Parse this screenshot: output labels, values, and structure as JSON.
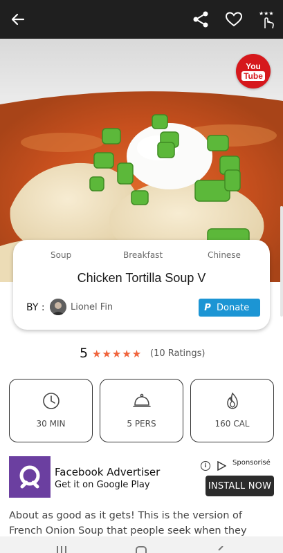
{
  "header": {
    "back_icon": "arrow-left-icon",
    "share_icon": "share-icon",
    "favorite_icon": "heart-icon",
    "rate_icon": "hand-stars-icon"
  },
  "hero": {
    "youtube_you": "You",
    "youtube_tube": "Tube"
  },
  "recipe": {
    "tags": [
      "Soup",
      "Breakfast",
      "Chinese"
    ],
    "title": "Chicken Tortilla Soup V",
    "by_label": "BY :",
    "author": "Lionel Fin",
    "donate_label": "Donate"
  },
  "rating": {
    "value": "5",
    "stars": "★★★★★",
    "count": "(10 Ratings)"
  },
  "stats": [
    {
      "icon": "clock-icon",
      "label": "30 MIN"
    },
    {
      "icon": "serving-cloche-icon",
      "label": "5 PERS"
    },
    {
      "icon": "flame-icon",
      "label": "160 CAL"
    }
  ],
  "ad": {
    "title": "Facebook Advertiser",
    "subtitle": "Get it on Google Play",
    "sponsored": "Sponsorisé",
    "install": "INSTALL NOW"
  },
  "description": "About as good as it gets! This is the version of French Onion Soup that people seek when they",
  "colors": {
    "topbar": "#1f1f1f",
    "accent_star": "#f0643c",
    "donate": "#1c95d4",
    "youtube": "#d6181c",
    "ad_logo": "#6b3fa0"
  }
}
